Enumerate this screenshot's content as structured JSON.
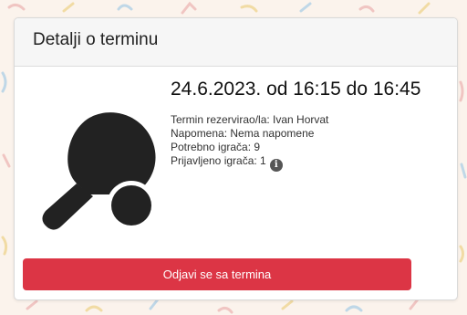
{
  "card": {
    "title": "Detalji o terminu"
  },
  "term": {
    "datetime": "24.6.2023. od 16:15 do 16:45",
    "reserved_by": "Termin rezervirao/la: Ivan Horvat",
    "note": "Napomena: Nema napomene",
    "required_players": "Potrebno igrača: 9",
    "registered_players": "Prijavljeno igrača: 1"
  },
  "actions": {
    "unregister_label": "Odjavi se sa termina"
  },
  "icons": {
    "sport": "table-tennis-paddle-icon",
    "info": "info-icon"
  },
  "colors": {
    "danger": "#dc3545",
    "icon": "#222222",
    "header_bg": "#f6f6f6"
  }
}
